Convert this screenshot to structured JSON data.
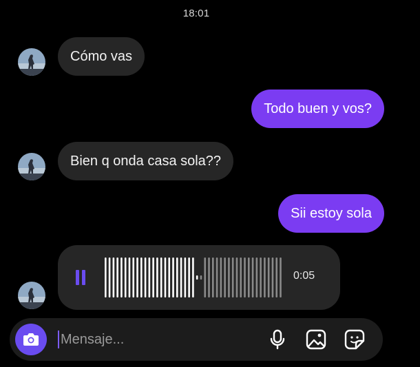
{
  "header": {
    "time": "18:01"
  },
  "messages": [
    {
      "direction": "in",
      "text": "Cómo vas"
    },
    {
      "direction": "out",
      "text": "Todo buen y vos?"
    },
    {
      "direction": "in",
      "text": "Bien q onda casa sola??"
    },
    {
      "direction": "out",
      "text": "Sii estoy sola"
    }
  ],
  "voice_message": {
    "direction": "in",
    "state": "playing",
    "icon": "pause-icon",
    "duration": "0:05",
    "progress": 0.53
  },
  "composer": {
    "placeholder": "Mensaje...",
    "icons": [
      "camera-icon",
      "microphone-icon",
      "image-icon",
      "sticker-icon"
    ]
  },
  "colors": {
    "background": "#000000",
    "incoming_bubble": "#262626",
    "outgoing_bubble": "#7b3cf2",
    "accent": "#6a4cf0"
  }
}
